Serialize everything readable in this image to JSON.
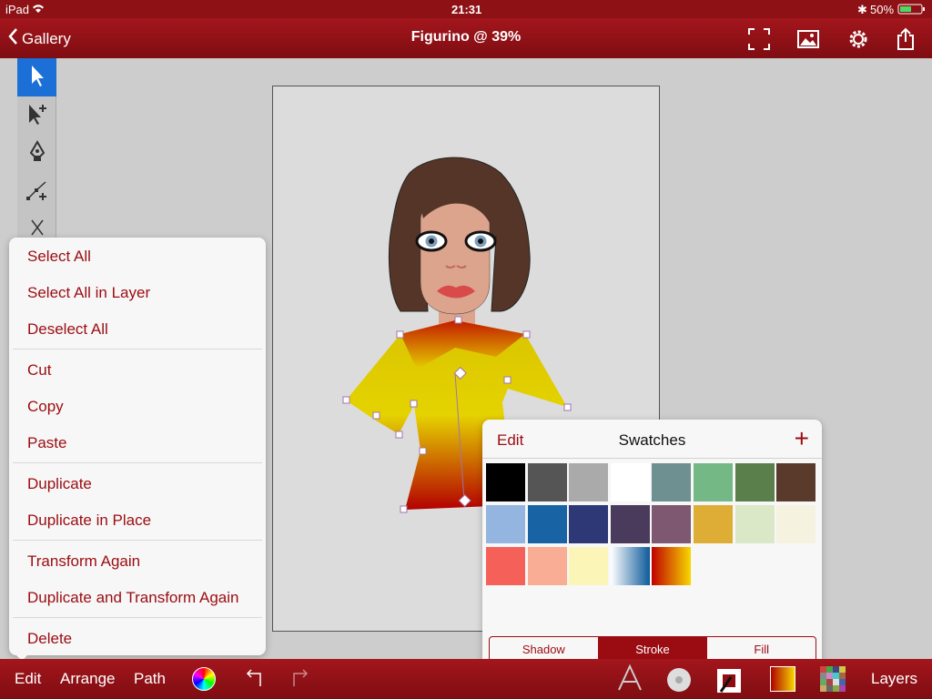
{
  "status": {
    "device": "iPad",
    "time": "21:31",
    "battery": "50%"
  },
  "nav": {
    "back_label": "Gallery",
    "title": "Figurino @ 39%"
  },
  "menu": {
    "groups": [
      [
        "Select All",
        "Select All in Layer",
        "Deselect All"
      ],
      [
        "Cut",
        "Copy",
        "Paste"
      ],
      [
        "Duplicate",
        "Duplicate in Place"
      ],
      [
        "Transform Again",
        "Duplicate and Transform Again"
      ],
      [
        "Delete"
      ]
    ]
  },
  "swatches": {
    "edit_label": "Edit",
    "title": "Swatches",
    "add_label": "+",
    "colors": [
      "#000000",
      "#555555",
      "#aaaaaa",
      "#ffffff",
      "#6e9090",
      "#74b886",
      "#5a7f4b",
      "#5a3a2a",
      "#93b5e0",
      "#1763a3",
      "#2e3877",
      "#4a3a5c",
      "#7e5870",
      "#ddad35",
      "#dbe8c7",
      "#f5f2df",
      "#f56158",
      "#f9ad94",
      "#fbf6b8",
      "gradient-blue",
      "gradient-red-yellow"
    ],
    "segments": [
      "Shadow",
      "Stroke",
      "Fill"
    ],
    "selected_segment": "Stroke"
  },
  "bottom": {
    "edit": "Edit",
    "arrange": "Arrange",
    "path": "Path",
    "layers": "Layers",
    "icons": [
      "color-wheel-icon",
      "undo-icon",
      "redo-icon",
      "text-icon",
      "paint-bucket-icon",
      "stroke-icon",
      "fill-gradient-icon",
      "pattern-icon"
    ]
  },
  "accent": "#9b0c12"
}
